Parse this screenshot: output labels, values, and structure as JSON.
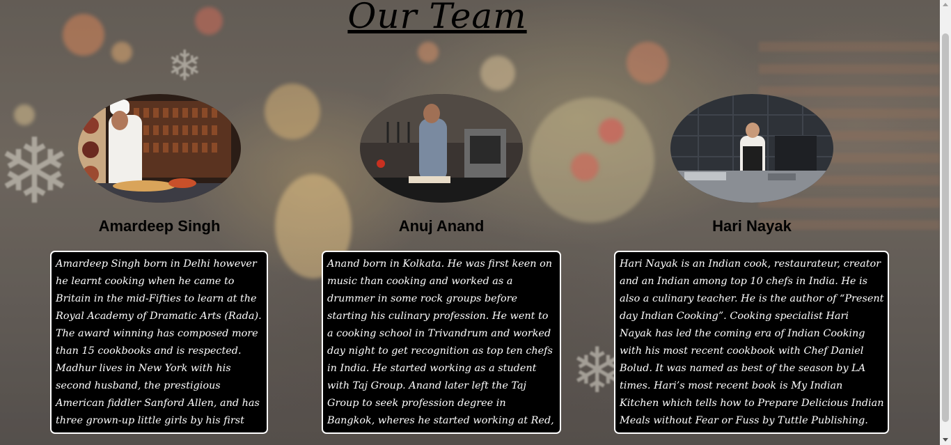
{
  "page": {
    "title": "Our Team"
  },
  "team": [
    {
      "name": "Amardeep Singh",
      "photo_icon": "chef-photo",
      "bio": "Amardeep Singh born in Delhi however he learnt cooking when he came to Britain in the mid-Fifties to learn at the Royal Academy of Dramatic Arts (Rada). The award winning has composed more than 15 cookbooks and is respected. Madhur lives in New York with his second husband, the prestigious American fiddler Sanford Allen, and has three grown-up little girls by his first spouse, the performer Saeed Jaffrey."
    },
    {
      "name": "Anuj Anand",
      "photo_icon": "chef-photo",
      "bio": "Anand born in Kolkata. He was first keen on music than cooking and worked as a drummer in some rock groups before starting his culinary profession. He went to a cooking school in Trivandrum and worked day night to get recognition as top ten chefs in India. He started working as a student with Taj Group. Anand later left the Taj Group to seek profession degree in Bangkok, wheres he started working at Red, eatery that spent time learning more Indian food."
    },
    {
      "name": "Hari Nayak",
      "photo_icon": "chef-photo",
      "bio": "Hari Nayak is an Indian cook, restaurateur, creator and an Indian among top 10 chefs in India. He is also a culinary teacher. He is the author of “Present day Indian Cooking”. Cooking specialist Hari Nayak has led the coming era of Indian Cooking with his most recent cookbook with Chef Daniel Bolud. It was named as best of the season by LA times. Hari’s most recent book is My Indian Kitchen which tells how to Prepare Delicious Indian Meals without Fear or Fuss by Tuttle Publishing."
    }
  ]
}
